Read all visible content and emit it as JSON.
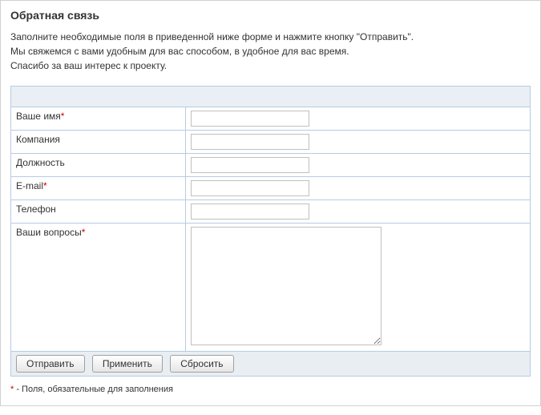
{
  "title": "Обратная связь",
  "intro_lines": [
    "Заполните необходимые поля в приведенной ниже форме и нажмите кнопку \"Отправить\".",
    "Мы свяжемся с вами удобным для вас способом, в удобное для вас время.",
    "Спасибо за ваш интерес к проекту."
  ],
  "fields": {
    "name": {
      "label": "Ваше имя",
      "required": true,
      "value": ""
    },
    "company": {
      "label": "Компания",
      "required": false,
      "value": ""
    },
    "position": {
      "label": "Должность",
      "required": false,
      "value": ""
    },
    "email": {
      "label": "E-mail",
      "required": true,
      "value": ""
    },
    "phone": {
      "label": "Телефон",
      "required": false,
      "value": ""
    },
    "questions": {
      "label": "Ваши вопросы",
      "required": true,
      "value": ""
    }
  },
  "buttons": {
    "submit": "Отправить",
    "apply": "Применить",
    "reset": "Сбросить"
  },
  "required_marker": "*",
  "footnote_text": " - Поля, обязательные для заполнения"
}
